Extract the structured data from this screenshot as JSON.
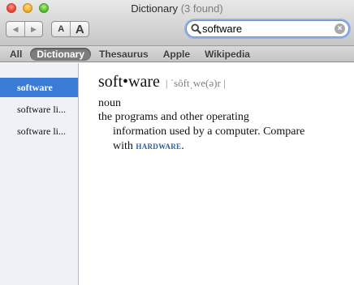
{
  "window": {
    "title": "Dictionary",
    "found_count": "(3 found)"
  },
  "toolbar": {
    "back_glyph": "◀",
    "forward_glyph": "▶",
    "font_smaller_label": "A",
    "font_larger_label": "A"
  },
  "search": {
    "value": "software",
    "placeholder": "",
    "clear_glyph": "×",
    "focus_color": "#8db2ec"
  },
  "scope_tabs": [
    {
      "label": "All",
      "active": false
    },
    {
      "label": "Dictionary",
      "active": true
    },
    {
      "label": "Thesaurus",
      "active": false
    },
    {
      "label": "Apple",
      "active": false
    },
    {
      "label": "Wikipedia",
      "active": false
    }
  ],
  "results": [
    {
      "label": "software",
      "selected": true
    },
    {
      "label": "software li...",
      "selected": false
    },
    {
      "label": "software li...",
      "selected": false
    }
  ],
  "entry": {
    "headword": "soft•ware",
    "pronunciation": "| ˈsôftˌwe(ə)r |",
    "part_of_speech": "noun",
    "definition_line1": "the programs and other operating",
    "definition_line2": "information used by a computer. Compare",
    "definition_line3_prefix": "with",
    "cross_reference": "hardware",
    "definition_suffix": "."
  },
  "colors": {
    "selection": "#3a7bd5",
    "cross_reference": "#2b5ea8",
    "active_scope": "#7d7d7d"
  },
  "icons": {
    "search": "magnifier-icon",
    "clear": "clear-circle-icon",
    "back": "triangle-left-icon",
    "forward": "triangle-right-icon"
  }
}
